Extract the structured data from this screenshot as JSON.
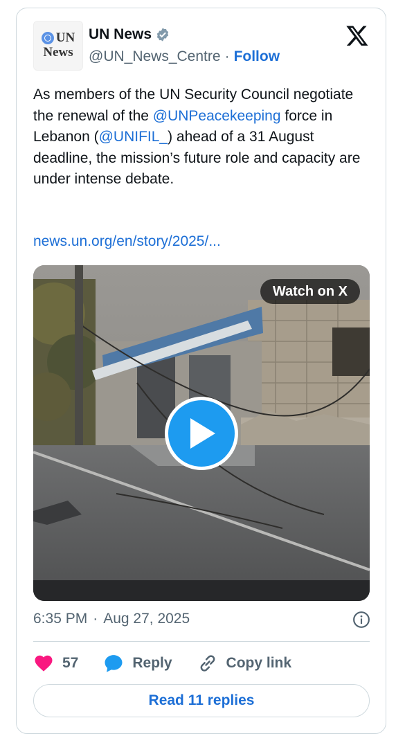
{
  "author": {
    "name": "UN News",
    "handle": "@UN_News_Centre",
    "separator": "·",
    "follow_label": "Follow",
    "avatar_line1": "UN",
    "avatar_line2": "News",
    "verified": true
  },
  "tweet": {
    "text_part1": "As members of the UN Security Council negotiate the renewal of the ",
    "mention1": "@UNPeacekeeping",
    "text_part2": " force in Lebanon (",
    "mention2": "@UNIFIL_",
    "text_part3": ") ahead of a 31 August deadline, the mission’s future role and capacity are under intense debate.",
    "link": "news.un.org/en/story/2025/..."
  },
  "media": {
    "watch_label": "Watch on X",
    "icon": "play-icon"
  },
  "meta": {
    "time": "6:35 PM",
    "separator": "·",
    "date": "Aug 27, 2025"
  },
  "actions": {
    "like_count": "57",
    "reply_label": "Reply",
    "copy_label": "Copy link"
  },
  "replies_button": "Read 11 replies",
  "colors": {
    "accent": "#1d9bf0",
    "link": "#1d6fd6",
    "like": "#f91880",
    "muted": "#536471",
    "border": "#cfd9de"
  }
}
